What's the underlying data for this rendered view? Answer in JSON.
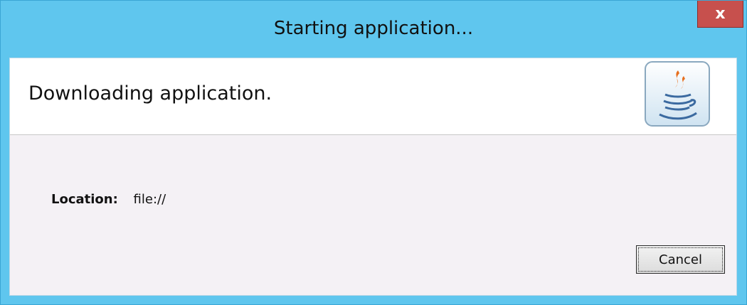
{
  "window": {
    "title": "Starting application...",
    "close_label": "x"
  },
  "header": {
    "text": "Downloading application.",
    "icon": "java-logo-icon"
  },
  "location": {
    "label": "Location:",
    "value": "file://"
  },
  "buttons": {
    "cancel_label": "Cancel"
  },
  "colors": {
    "titlebar": "#5fc6ee",
    "close_button": "#c7504d",
    "client_background": "#f4f1f5",
    "header_background": "#ffffff"
  }
}
